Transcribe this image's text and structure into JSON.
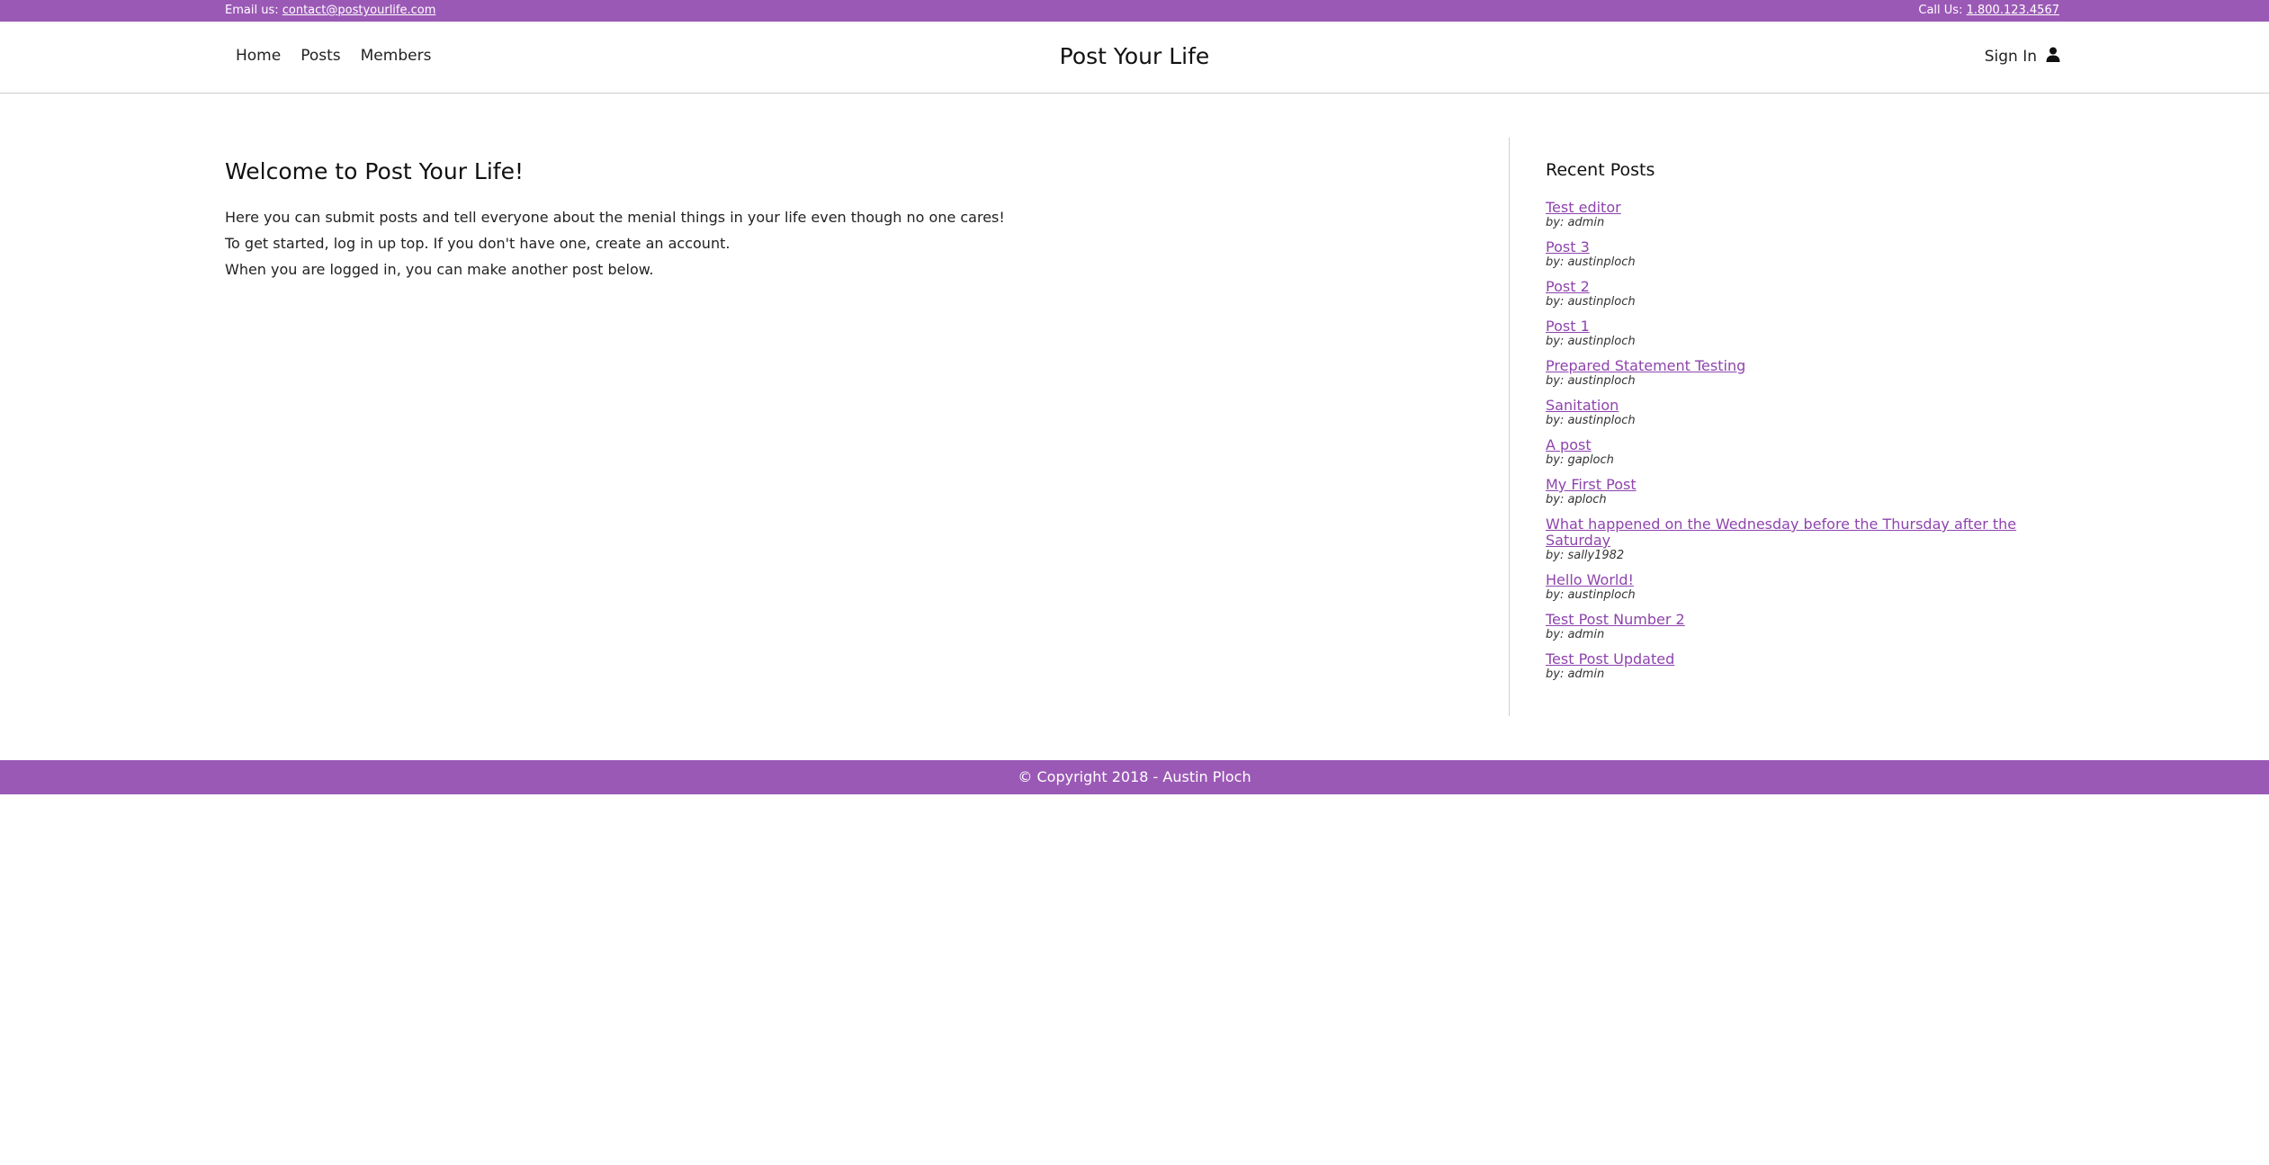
{
  "topbar": {
    "email_label": "Email us:",
    "email": "contact@postyourlife.com",
    "phone_label": "Call Us:",
    "phone": "1.800.123.4567"
  },
  "nav": {
    "items": [
      {
        "label": "Home"
      },
      {
        "label": "Posts"
      },
      {
        "label": "Members"
      }
    ],
    "brand": "Post Your Life",
    "signin_label": "Sign In",
    "signin_icon": "user-icon"
  },
  "main": {
    "title": "Welcome to Post Your Life!",
    "lines": [
      "Here you can submit posts and tell everyone about the menial things in your life even though no one cares!",
      "To get started, log in up top. If you don't have one, create an account.",
      "When you are logged in, you can make another post below."
    ]
  },
  "sidebar": {
    "title": "Recent Posts",
    "posts": [
      {
        "title": "Test editor",
        "by": "by: admin"
      },
      {
        "title": "Post 3",
        "by": "by: austinploch"
      },
      {
        "title": "Post 2",
        "by": "by: austinploch"
      },
      {
        "title": "Post 1",
        "by": "by: austinploch"
      },
      {
        "title": "Prepared Statement Testing",
        "by": "by: austinploch"
      },
      {
        "title": "Sanitation",
        "by": "by: austinploch"
      },
      {
        "title": "A post",
        "by": "by: gaploch"
      },
      {
        "title": "My First Post",
        "by": "by: aploch"
      },
      {
        "title": "What happened on the Wednesday before the Thursday after the Saturday",
        "by": "by: sally1982"
      },
      {
        "title": "Hello World!",
        "by": "by: austinploch"
      },
      {
        "title": "Test Post Number 2",
        "by": "by: admin"
      },
      {
        "title": "Test Post Updated",
        "by": "by: admin"
      }
    ]
  },
  "footer": {
    "text": "© Copyright 2018 - Austin Ploch"
  },
  "colors": {
    "accent": "#9b59b6",
    "link": "#8e44ad"
  }
}
